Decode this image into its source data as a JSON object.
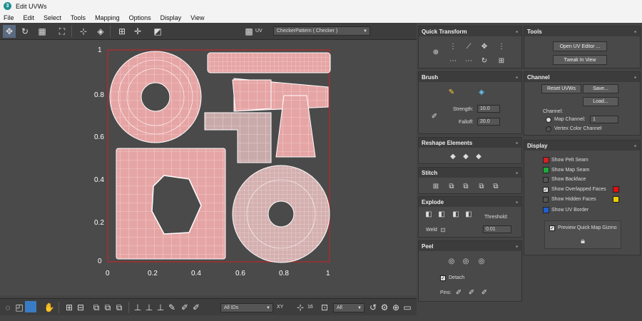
{
  "window": {
    "title": "Edit UVWs",
    "app_icon": "3"
  },
  "menu": [
    "File",
    "Edit",
    "Select",
    "Tools",
    "Mapping",
    "Options",
    "Display",
    "View"
  ],
  "toolbar": {
    "uv_label": "UV",
    "texture_dropdown": "CheckerPattern  ( Checker )"
  },
  "axes": {
    "x_ticks": [
      "0",
      "0.2",
      "0.4",
      "0.6",
      "0.8",
      "1"
    ],
    "y_ticks": [
      "1",
      "0.8",
      "0.6",
      "0.4",
      "0.2",
      "0"
    ]
  },
  "bottom": {
    "ids_dropdown": "All IDs",
    "xy_label": "XY",
    "grid_value": "16",
    "all_dropdown": "All"
  },
  "quick_transform": {
    "title": "Quick Transform"
  },
  "brush": {
    "title": "Brush",
    "strength_label": "Strength:",
    "strength_value": "10.0",
    "falloff_label": "Falloff:",
    "falloff_value": "20.0"
  },
  "reshape": {
    "title": "Reshape Elements"
  },
  "stitch": {
    "title": "Stitch"
  },
  "explode": {
    "title": "Explode",
    "threshold_label": "Threshold:",
    "weld_label": "Weld",
    "threshold_value": "0.01"
  },
  "peel": {
    "title": "Peel",
    "detach_label": "Detach",
    "pins_label": "Pins:"
  },
  "tools": {
    "title": "Tools",
    "open_uv_editor": "Open UV Editor ...",
    "tweak_in_view": "Tweak In View"
  },
  "channel": {
    "title": "Channel",
    "reset_uvws": "Reset UVWs",
    "save": "Save...",
    "load": "Load...",
    "channel_label": "Channel:",
    "map_channel_label": "Map Channel:",
    "map_channel_value": "1",
    "vertex_color_channel": "Vertex Color Channel"
  },
  "display": {
    "title": "Display",
    "show_pelt_seam": "Show Pelt Seam",
    "show_map_seam": "Show Map Seam",
    "show_backface": "Show Backface",
    "show_overlapped": "Show Overlapped Faces",
    "show_hidden": "Show Hidden Faces",
    "show_uv_border": "Show UV Border",
    "preview_gizmo": "Preview Quick Map Gizmo",
    "colors": {
      "pelt": "#d42020",
      "map": "#1fa83a",
      "overlapped": "#e01010",
      "hidden": "#e8d000",
      "border": "#2060d0"
    }
  }
}
